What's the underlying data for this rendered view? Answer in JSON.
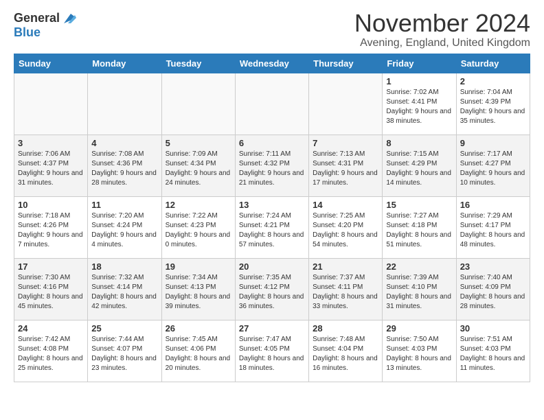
{
  "logo": {
    "general": "General",
    "blue": "Blue"
  },
  "header": {
    "title": "November 2024",
    "subtitle": "Avening, England, United Kingdom"
  },
  "weekdays": [
    "Sunday",
    "Monday",
    "Tuesday",
    "Wednesday",
    "Thursday",
    "Friday",
    "Saturday"
  ],
  "weeks": [
    [
      {
        "day": "",
        "sunrise": "",
        "sunset": "",
        "daylight": ""
      },
      {
        "day": "",
        "sunrise": "",
        "sunset": "",
        "daylight": ""
      },
      {
        "day": "",
        "sunrise": "",
        "sunset": "",
        "daylight": ""
      },
      {
        "day": "",
        "sunrise": "",
        "sunset": "",
        "daylight": ""
      },
      {
        "day": "",
        "sunrise": "",
        "sunset": "",
        "daylight": ""
      },
      {
        "day": "1",
        "sunrise": "Sunrise: 7:02 AM",
        "sunset": "Sunset: 4:41 PM",
        "daylight": "Daylight: 9 hours and 38 minutes."
      },
      {
        "day": "2",
        "sunrise": "Sunrise: 7:04 AM",
        "sunset": "Sunset: 4:39 PM",
        "daylight": "Daylight: 9 hours and 35 minutes."
      }
    ],
    [
      {
        "day": "3",
        "sunrise": "Sunrise: 7:06 AM",
        "sunset": "Sunset: 4:37 PM",
        "daylight": "Daylight: 9 hours and 31 minutes."
      },
      {
        "day": "4",
        "sunrise": "Sunrise: 7:08 AM",
        "sunset": "Sunset: 4:36 PM",
        "daylight": "Daylight: 9 hours and 28 minutes."
      },
      {
        "day": "5",
        "sunrise": "Sunrise: 7:09 AM",
        "sunset": "Sunset: 4:34 PM",
        "daylight": "Daylight: 9 hours and 24 minutes."
      },
      {
        "day": "6",
        "sunrise": "Sunrise: 7:11 AM",
        "sunset": "Sunset: 4:32 PM",
        "daylight": "Daylight: 9 hours and 21 minutes."
      },
      {
        "day": "7",
        "sunrise": "Sunrise: 7:13 AM",
        "sunset": "Sunset: 4:31 PM",
        "daylight": "Daylight: 9 hours and 17 minutes."
      },
      {
        "day": "8",
        "sunrise": "Sunrise: 7:15 AM",
        "sunset": "Sunset: 4:29 PM",
        "daylight": "Daylight: 9 hours and 14 minutes."
      },
      {
        "day": "9",
        "sunrise": "Sunrise: 7:17 AM",
        "sunset": "Sunset: 4:27 PM",
        "daylight": "Daylight: 9 hours and 10 minutes."
      }
    ],
    [
      {
        "day": "10",
        "sunrise": "Sunrise: 7:18 AM",
        "sunset": "Sunset: 4:26 PM",
        "daylight": "Daylight: 9 hours and 7 minutes."
      },
      {
        "day": "11",
        "sunrise": "Sunrise: 7:20 AM",
        "sunset": "Sunset: 4:24 PM",
        "daylight": "Daylight: 9 hours and 4 minutes."
      },
      {
        "day": "12",
        "sunrise": "Sunrise: 7:22 AM",
        "sunset": "Sunset: 4:23 PM",
        "daylight": "Daylight: 9 hours and 0 minutes."
      },
      {
        "day": "13",
        "sunrise": "Sunrise: 7:24 AM",
        "sunset": "Sunset: 4:21 PM",
        "daylight": "Daylight: 8 hours and 57 minutes."
      },
      {
        "day": "14",
        "sunrise": "Sunrise: 7:25 AM",
        "sunset": "Sunset: 4:20 PM",
        "daylight": "Daylight: 8 hours and 54 minutes."
      },
      {
        "day": "15",
        "sunrise": "Sunrise: 7:27 AM",
        "sunset": "Sunset: 4:18 PM",
        "daylight": "Daylight: 8 hours and 51 minutes."
      },
      {
        "day": "16",
        "sunrise": "Sunrise: 7:29 AM",
        "sunset": "Sunset: 4:17 PM",
        "daylight": "Daylight: 8 hours and 48 minutes."
      }
    ],
    [
      {
        "day": "17",
        "sunrise": "Sunrise: 7:30 AM",
        "sunset": "Sunset: 4:16 PM",
        "daylight": "Daylight: 8 hours and 45 minutes."
      },
      {
        "day": "18",
        "sunrise": "Sunrise: 7:32 AM",
        "sunset": "Sunset: 4:14 PM",
        "daylight": "Daylight: 8 hours and 42 minutes."
      },
      {
        "day": "19",
        "sunrise": "Sunrise: 7:34 AM",
        "sunset": "Sunset: 4:13 PM",
        "daylight": "Daylight: 8 hours and 39 minutes."
      },
      {
        "day": "20",
        "sunrise": "Sunrise: 7:35 AM",
        "sunset": "Sunset: 4:12 PM",
        "daylight": "Daylight: 8 hours and 36 minutes."
      },
      {
        "day": "21",
        "sunrise": "Sunrise: 7:37 AM",
        "sunset": "Sunset: 4:11 PM",
        "daylight": "Daylight: 8 hours and 33 minutes."
      },
      {
        "day": "22",
        "sunrise": "Sunrise: 7:39 AM",
        "sunset": "Sunset: 4:10 PM",
        "daylight": "Daylight: 8 hours and 31 minutes."
      },
      {
        "day": "23",
        "sunrise": "Sunrise: 7:40 AM",
        "sunset": "Sunset: 4:09 PM",
        "daylight": "Daylight: 8 hours and 28 minutes."
      }
    ],
    [
      {
        "day": "24",
        "sunrise": "Sunrise: 7:42 AM",
        "sunset": "Sunset: 4:08 PM",
        "daylight": "Daylight: 8 hours and 25 minutes."
      },
      {
        "day": "25",
        "sunrise": "Sunrise: 7:44 AM",
        "sunset": "Sunset: 4:07 PM",
        "daylight": "Daylight: 8 hours and 23 minutes."
      },
      {
        "day": "26",
        "sunrise": "Sunrise: 7:45 AM",
        "sunset": "Sunset: 4:06 PM",
        "daylight": "Daylight: 8 hours and 20 minutes."
      },
      {
        "day": "27",
        "sunrise": "Sunrise: 7:47 AM",
        "sunset": "Sunset: 4:05 PM",
        "daylight": "Daylight: 8 hours and 18 minutes."
      },
      {
        "day": "28",
        "sunrise": "Sunrise: 7:48 AM",
        "sunset": "Sunset: 4:04 PM",
        "daylight": "Daylight: 8 hours and 16 minutes."
      },
      {
        "day": "29",
        "sunrise": "Sunrise: 7:50 AM",
        "sunset": "Sunset: 4:03 PM",
        "daylight": "Daylight: 8 hours and 13 minutes."
      },
      {
        "day": "30",
        "sunrise": "Sunrise: 7:51 AM",
        "sunset": "Sunset: 4:03 PM",
        "daylight": "Daylight: 8 hours and 11 minutes."
      }
    ]
  ]
}
